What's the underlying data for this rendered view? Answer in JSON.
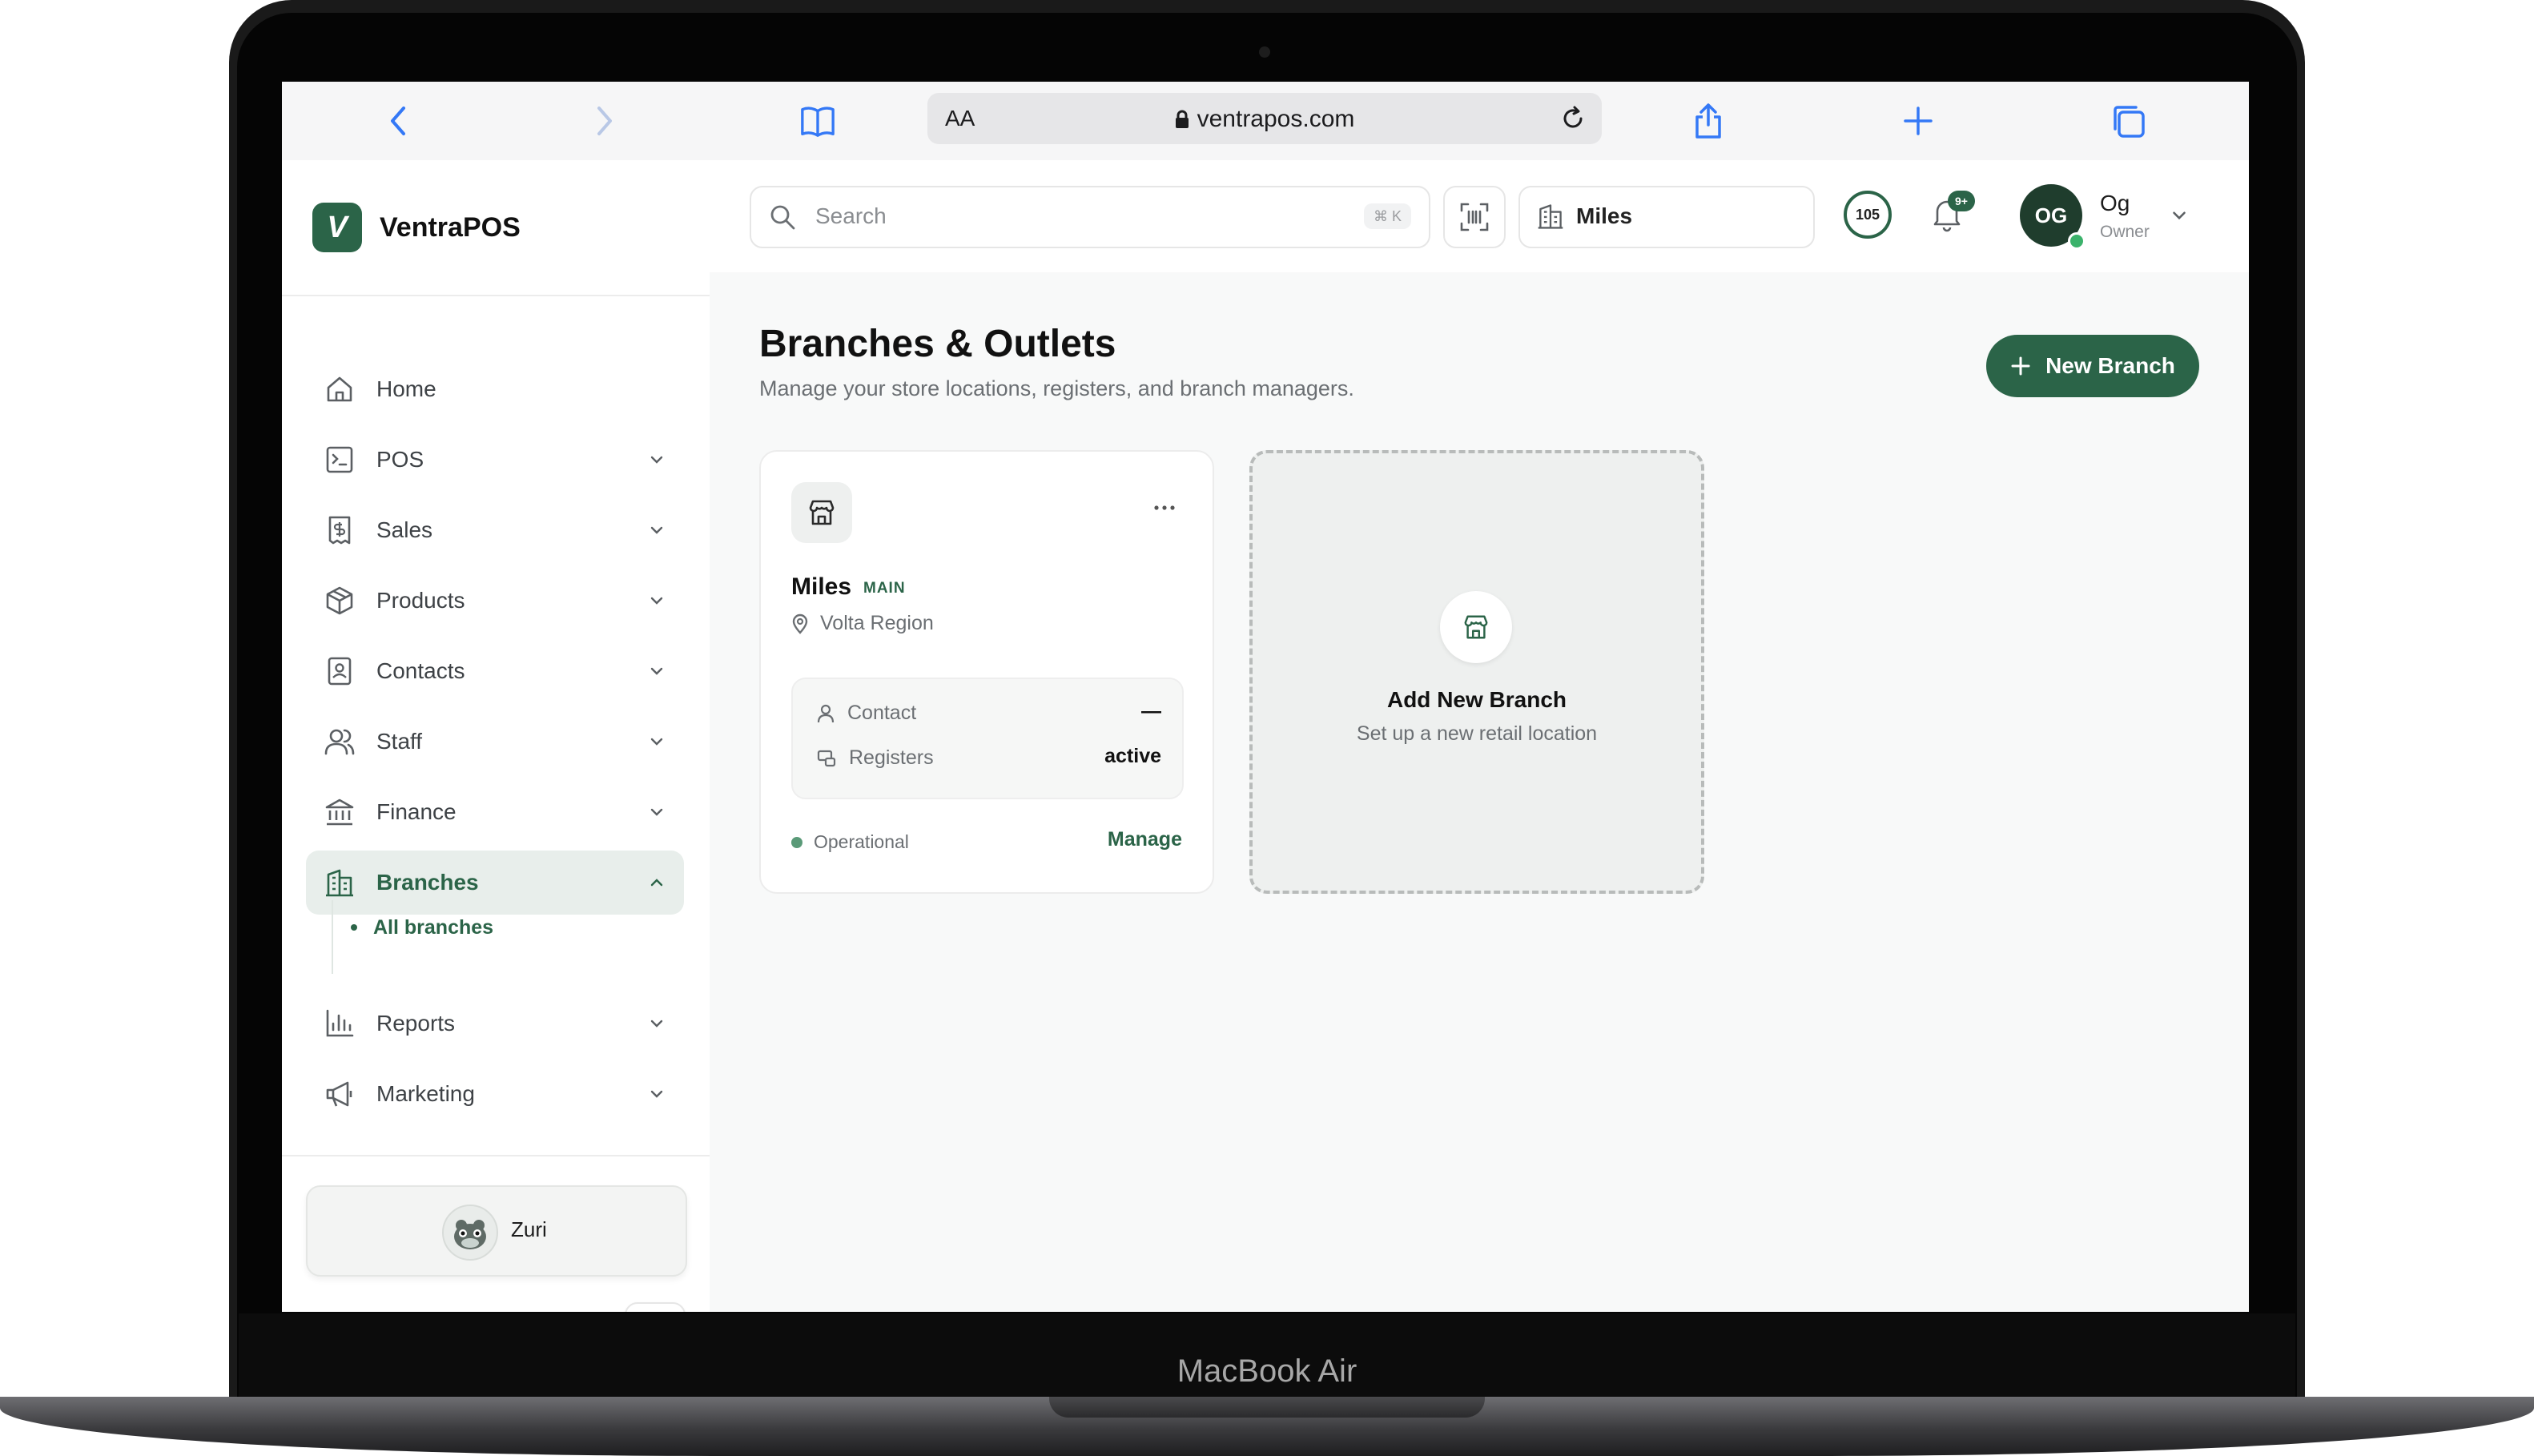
{
  "device": {
    "label": "MacBook Air"
  },
  "browser": {
    "reader_label": "AA",
    "url": "ventrapos.com"
  },
  "app": {
    "name": "VentraPOS",
    "logo_letter": "V",
    "brand_color": "#2b6448"
  },
  "sidebar": {
    "items": [
      {
        "label": "Home",
        "icon": "home-icon",
        "expandable": false
      },
      {
        "label": "POS",
        "icon": "terminal-icon",
        "expandable": true
      },
      {
        "label": "Sales",
        "icon": "receipt-icon",
        "expandable": true
      },
      {
        "label": "Products",
        "icon": "box-icon",
        "expandable": true
      },
      {
        "label": "Contacts",
        "icon": "contact-book-icon",
        "expandable": true
      },
      {
        "label": "Staff",
        "icon": "users-icon",
        "expandable": true
      },
      {
        "label": "Finance",
        "icon": "bank-icon",
        "expandable": true
      },
      {
        "label": "Branches",
        "icon": "building-icon",
        "expandable": true,
        "active": true
      },
      {
        "label": "Reports",
        "icon": "bar-chart-icon",
        "expandable": true
      },
      {
        "label": "Marketing",
        "icon": "megaphone-icon",
        "expandable": true
      }
    ],
    "sub_items": [
      {
        "label": "All branches",
        "active": true
      }
    ],
    "assistant": {
      "name": "Zuri"
    }
  },
  "topbar": {
    "search_placeholder": "Search",
    "search_shortcut": "⌘ K",
    "branch_selector": "Miles",
    "counter": "105",
    "notifications_badge": "9+",
    "user": {
      "initials": "OG",
      "name": "Og",
      "role": "Owner"
    }
  },
  "main": {
    "title": "Branches & Outlets",
    "subtitle": "Manage your store locations, registers, and branch managers.",
    "new_branch_label": "New Branch",
    "branches": [
      {
        "name": "Miles",
        "badge": "MAIN",
        "location": "Volta Region",
        "contact_label": "Contact",
        "contact_value": "—",
        "registers_label": "Registers",
        "registers_value": "active",
        "status": "Operational",
        "manage_label": "Manage"
      }
    ],
    "add_card": {
      "title": "Add New Branch",
      "subtitle": "Set up a new retail location"
    }
  }
}
